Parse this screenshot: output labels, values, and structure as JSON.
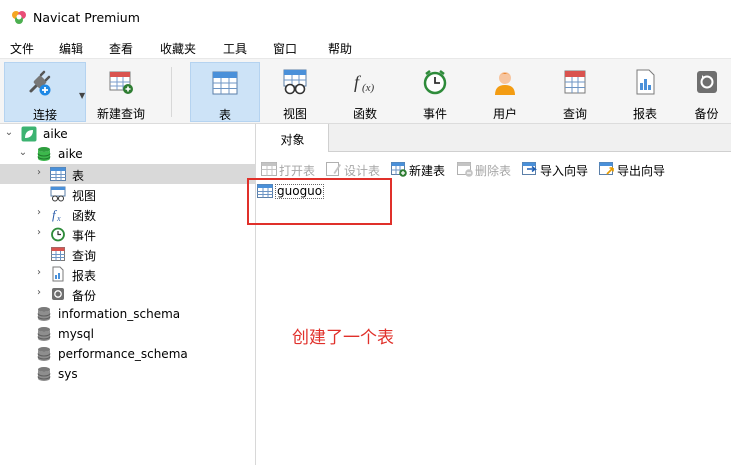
{
  "window": {
    "title": "Navicat Premium"
  },
  "menu": [
    "文件",
    "编辑",
    "查看",
    "收藏夹",
    "工具",
    "窗口",
    "帮助"
  ],
  "toolbar": {
    "connect": "连接",
    "new_query": "新建查询",
    "table": "表",
    "view": "视图",
    "function": "函数",
    "event": "事件",
    "user": "用户",
    "query": "查询",
    "report": "报表",
    "backup": "备份"
  },
  "tree": {
    "connection": "aike",
    "database": "aike",
    "nodes": [
      "表",
      "视图",
      "函数",
      "事件",
      "查询",
      "报表",
      "备份"
    ],
    "other_databases": [
      "information_schema",
      "mysql",
      "performance_schema",
      "sys"
    ]
  },
  "tabs": {
    "objects": "对象"
  },
  "object_toolbar": {
    "open_table": "打开表",
    "design_table": "设计表",
    "new_table": "新建表",
    "delete_table": "删除表",
    "import_wizard": "导入向导",
    "export_wizard": "导出向导"
  },
  "objects": [
    "guoguo"
  ],
  "annotation": "创建了一个表",
  "colors": {
    "accent": "#cde3f7",
    "annotation": "#e0302a",
    "selected_row": "#d9d9d9"
  }
}
